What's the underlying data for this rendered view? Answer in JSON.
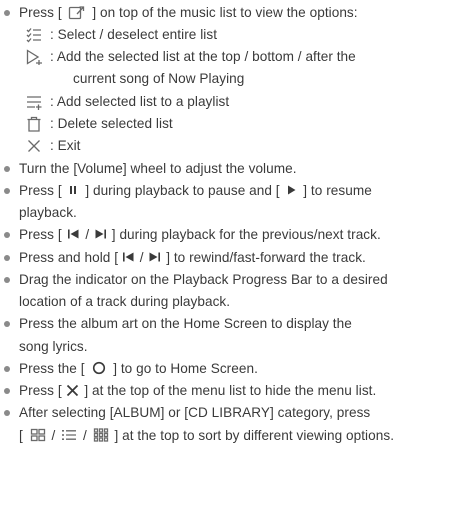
{
  "doc": {
    "options": {
      "pre": "Press [",
      "post": "] on top of the music list to view the options:"
    },
    "sub": {
      "select": ": Select / deselect entire list",
      "add_line1": ": Add the selected list at the top / bottom / after the",
      "add_line2": "current song of Now Playing",
      "playlist": ": Add selected list to a playlist",
      "delete": ": Delete selected list",
      "exit": ": Exit"
    },
    "volume": "Turn the [Volume] wheel to adjust the volume.",
    "pause": {
      "pre": "Press [",
      "mid": "] during playback to pause and [",
      "post": "] to resume",
      "line2": "playback."
    },
    "prevnext": {
      "pre": "Press [",
      "sep": "/",
      "post": "] during playback for the previous/next track."
    },
    "hold": {
      "pre": "Press and hold [",
      "sep": "/",
      "post": "] to rewind/fast-forward the track."
    },
    "drag": {
      "line1": "Drag the indicator on the Playback Progress Bar to a desired",
      "line2": "location of a track during playback."
    },
    "lyrics": {
      "line1": "Press the album art on the Home Screen to display the",
      "line2": "song lyrics."
    },
    "home": {
      "pre": "Press the [",
      "post": "] to go to Home Screen."
    },
    "hide": {
      "pre": "Press [",
      "post": "] at the top of the menu list to hide the menu list."
    },
    "sort": {
      "line1": "After selecting [ALBUM] or [CD LIBRARY] category, press",
      "pre": "[",
      "sep1": "/",
      "sep2": "/",
      "post": "] at the top to sort by different viewing options."
    }
  },
  "colors": {
    "text": "#3a3a3a",
    "bullet": "#8a8a8a",
    "icon": "#6a6a6a"
  },
  "icons": [
    "options-icon",
    "select-all-icon",
    "add-to-now-playing-icon",
    "add-to-playlist-icon",
    "trash-icon",
    "close-icon",
    "pause-icon",
    "play-icon",
    "previous-icon",
    "next-icon",
    "home-circle-icon",
    "grid-view-icon",
    "list-view-icon",
    "tile-view-icon"
  ]
}
